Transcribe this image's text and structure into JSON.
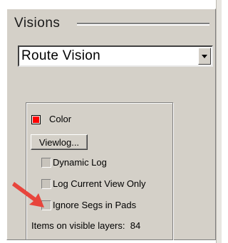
{
  "panel": {
    "title": "Visions"
  },
  "vision_select": {
    "selected": "Route Vision"
  },
  "options": {
    "color_label": "Color",
    "color_value": "#ff0000",
    "viewlog_label": "Viewlog...",
    "dynamic_log_label": "Dynamic Log",
    "log_current_view_label": "Log Current View Only",
    "ignore_segs_label": "Ignore Segs in Pads",
    "items_label": "Items on visible layers:",
    "items_count": "84"
  },
  "annotation": {
    "arrow_color": "#e8453c"
  }
}
